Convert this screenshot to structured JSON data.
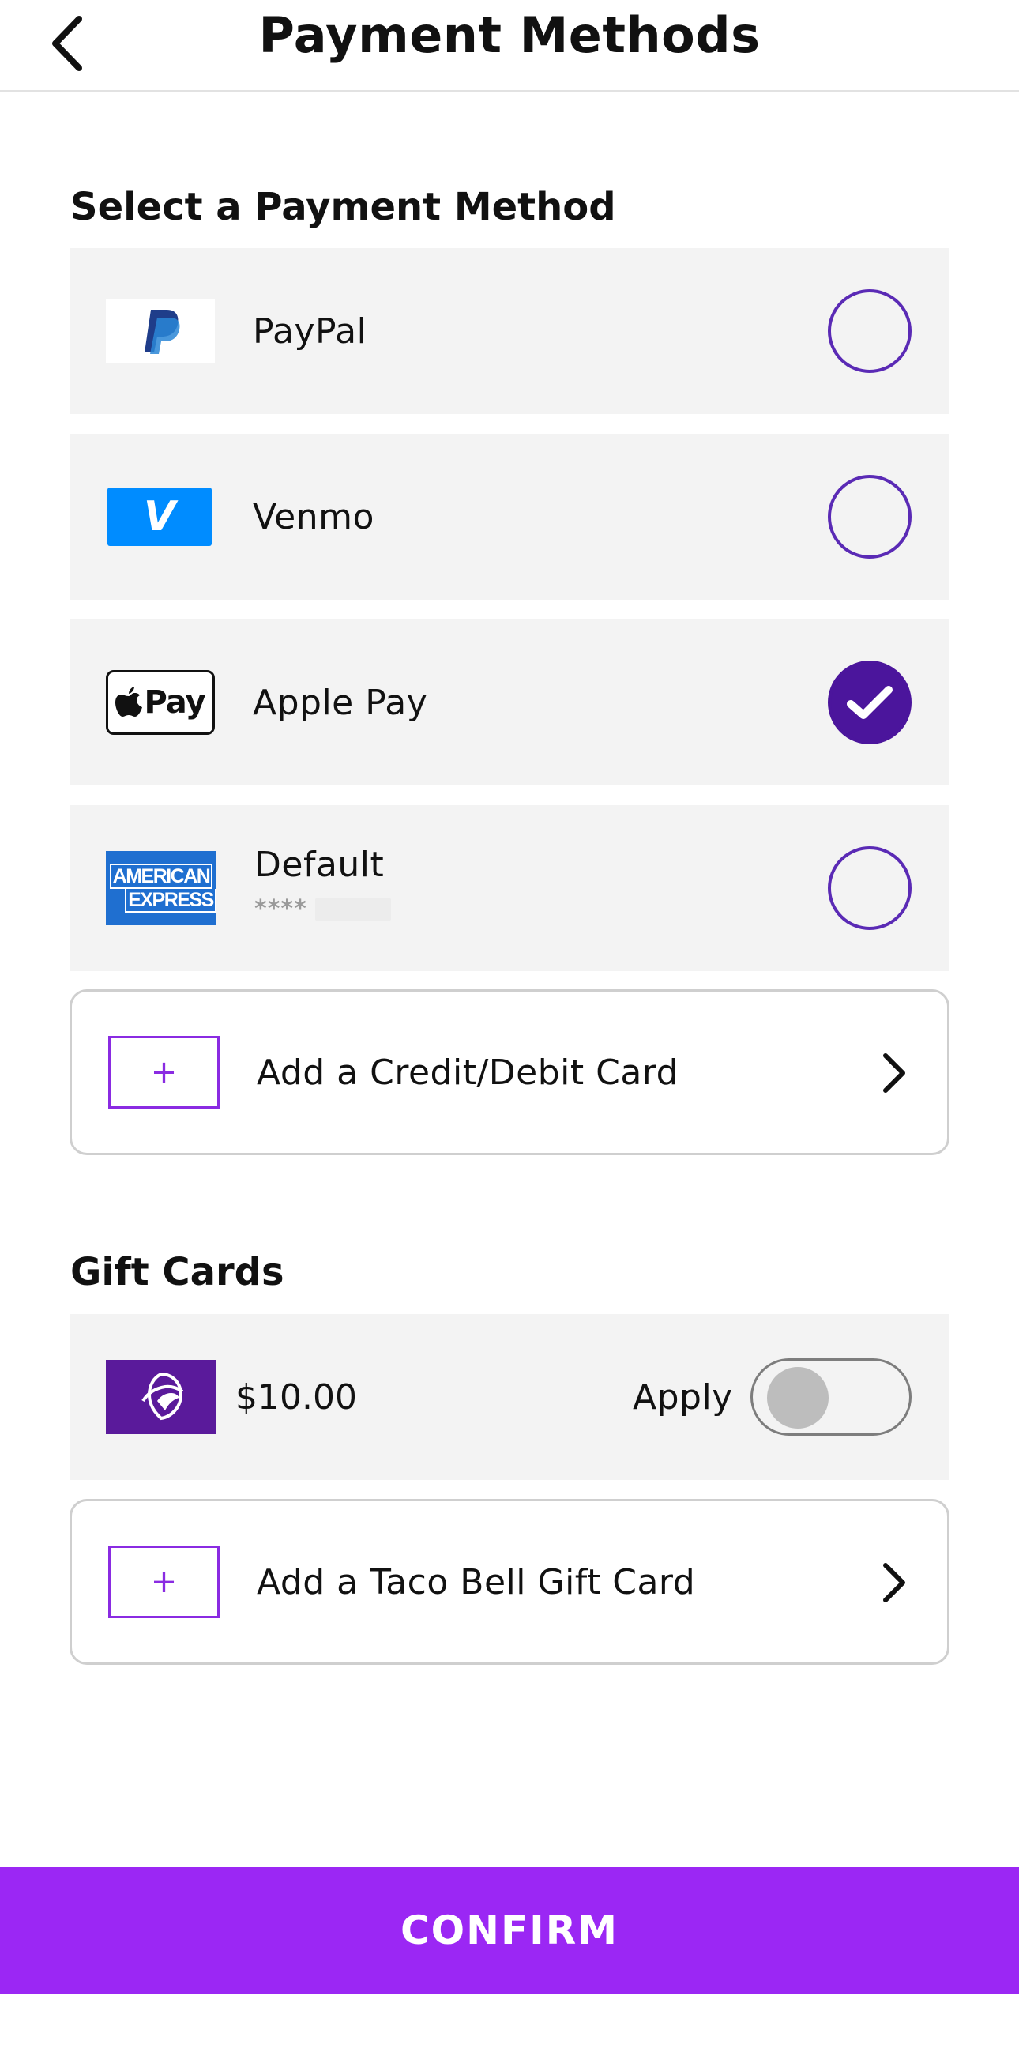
{
  "header": {
    "title": "Payment Methods",
    "back_icon": "chevron-left-icon"
  },
  "payment_section": {
    "title": "Select a Payment Method",
    "methods": [
      {
        "label": "PayPal",
        "icon": "paypal-logo",
        "selected": false
      },
      {
        "label": "Venmo",
        "icon": "venmo-logo",
        "logo_text": "V",
        "selected": false
      },
      {
        "label": "Apple Pay",
        "icon": "apple-pay-logo",
        "logo_text": "Pay",
        "selected": true
      },
      {
        "label": "Default",
        "icon": "amex-logo",
        "logo_line1": "AMERICAN",
        "logo_line2": "EXPRESS",
        "masked_number": "****",
        "selected": false
      }
    ],
    "add_card": {
      "label": "Add a Credit/Debit Card",
      "plus": "+"
    }
  },
  "gift_section": {
    "title": "Gift Cards",
    "card": {
      "amount": "$10.00",
      "apply_label": "Apply",
      "apply_on": false,
      "icon": "taco-bell-logo"
    },
    "add_gift": {
      "label": "Add a Taco Bell Gift Card",
      "plus": "+"
    }
  },
  "confirm_label": "CONFIRM",
  "colors": {
    "accent": "#9b27f4",
    "radio": "#4b159c",
    "row_bg": "#f3f3f3",
    "venmo": "#008cff",
    "amex": "#1f6fd0",
    "taco_bell": "#5a1a9b"
  }
}
